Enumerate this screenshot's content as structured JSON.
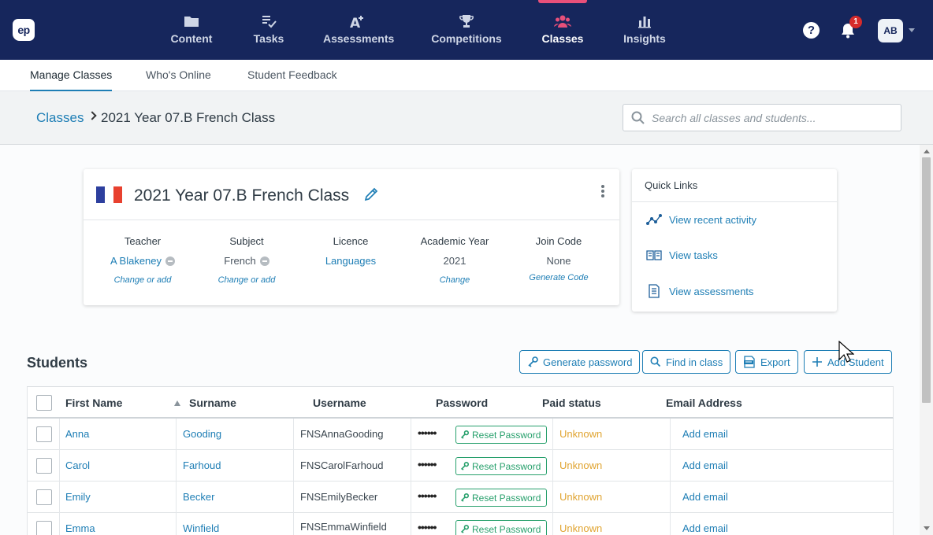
{
  "nav": {
    "logo": "ep",
    "items": [
      {
        "label": "Content",
        "icon": "folder-icon"
      },
      {
        "label": "Tasks",
        "icon": "tasks-icon"
      },
      {
        "label": "Assessments",
        "icon": "assessment-icon"
      },
      {
        "label": "Competitions",
        "icon": "trophy-icon"
      },
      {
        "label": "Classes",
        "icon": "people-icon",
        "active": true
      },
      {
        "label": "Insights",
        "icon": "bar-chart-icon"
      }
    ],
    "help": "?",
    "notification_count": "1",
    "avatar": "AB"
  },
  "subtabs": [
    "Manage Classes",
    "Who's Online",
    "Student Feedback"
  ],
  "breadcrumb": {
    "root": "Classes",
    "current": "2021 Year 07.B French Class"
  },
  "search": {
    "placeholder": "Search all classes and students..."
  },
  "class_card": {
    "title": "2021 Year 07.B French Class",
    "columns": [
      {
        "header": "Teacher",
        "value": "A Blakeney",
        "action": "Change or add"
      },
      {
        "header": "Subject",
        "value": "French",
        "action": "Change or add"
      },
      {
        "header": "Licence",
        "value": "Languages",
        "action": ""
      },
      {
        "header": "Academic Year",
        "value": "2021",
        "action": "Change"
      },
      {
        "header": "Join Code",
        "value": "None",
        "action": "Generate Code"
      }
    ]
  },
  "quick_links": {
    "title": "Quick Links",
    "items": [
      "View recent activity",
      "View tasks",
      "View assessments"
    ]
  },
  "students": {
    "title": "Students",
    "buttons": [
      "Generate password",
      "Find in class",
      "Export",
      "Add Student"
    ],
    "columns": [
      "First Name",
      "Surname",
      "Username",
      "Password",
      "Paid status",
      "Email Address"
    ],
    "rows": [
      {
        "first": "Anna",
        "surname": "Gooding",
        "username": "FNSAnnaGooding",
        "password": "••••••",
        "reset": "Reset Password",
        "paid": "Unknown",
        "email": "Add email"
      },
      {
        "first": "Carol",
        "surname": "Farhoud",
        "username": "FNSCarolFarhoud",
        "password": "••••••",
        "reset": "Reset Password",
        "paid": "Unknown",
        "email": "Add email"
      },
      {
        "first": "Emily",
        "surname": "Becker",
        "username": "FNSEmilyBecker",
        "password": "••••••",
        "reset": "Reset Password",
        "paid": "Unknown",
        "email": "Add email"
      },
      {
        "first": "Emma",
        "surname": "Winfield",
        "username": "FNSEmmaWinfield",
        "password": "••••••",
        "reset": "Reset Password",
        "paid": "Unknown",
        "email": "Add email"
      }
    ]
  },
  "colors": {
    "nav_bg": "#16265c",
    "accent": "#1e7eb5",
    "active_tab": "#e8507a",
    "success": "#27a06c",
    "warning": "#e0a431"
  }
}
